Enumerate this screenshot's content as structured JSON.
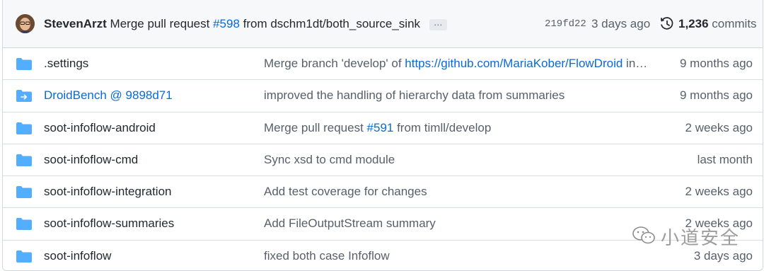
{
  "latest_commit": {
    "author": "StevenArzt",
    "message_prefix": "Merge pull request ",
    "pr": "#598",
    "message_suffix": " from dschm1dt/both_source_sink",
    "ellipsis": "…",
    "sha": "219fd22",
    "time": "3 days ago",
    "commit_count": "1,236",
    "commits_label": "commits"
  },
  "colors": {
    "folder": "#54aeff",
    "link": "#0969da",
    "muted": "#57606a"
  },
  "rows": [
    {
      "name": ".settings",
      "icon": "folder-icon",
      "type": "dir",
      "msg_prefix": "Merge branch 'develop' of ",
      "msg_link": "https://github.com/MariaKober/FlowDroid",
      "msg_suffix": " in…",
      "age": "9 months ago"
    },
    {
      "name": "DroidBench @ 9898d71",
      "icon": "submodule-icon",
      "type": "submodule",
      "msg_prefix": "improved the handling of hierarchy data from summaries",
      "msg_link": "",
      "msg_suffix": "",
      "age": "9 months ago"
    },
    {
      "name": "soot-infoflow-android",
      "icon": "folder-icon",
      "type": "dir",
      "msg_prefix": "Merge pull request ",
      "msg_link": "#591",
      "msg_suffix": " from timll/develop",
      "age": "2 weeks ago"
    },
    {
      "name": "soot-infoflow-cmd",
      "icon": "folder-icon",
      "type": "dir",
      "msg_prefix": "Sync xsd to cmd module",
      "msg_link": "",
      "msg_suffix": "",
      "age": "last month"
    },
    {
      "name": "soot-infoflow-integration",
      "icon": "folder-icon",
      "type": "dir",
      "msg_prefix": "Add test coverage for changes",
      "msg_link": "",
      "msg_suffix": "",
      "age": "2 weeks ago"
    },
    {
      "name": "soot-infoflow-summaries",
      "icon": "folder-icon",
      "type": "dir",
      "msg_prefix": "Add FileOutputStream summary",
      "msg_link": "",
      "msg_suffix": "",
      "age": "2 weeks ago"
    },
    {
      "name": "soot-infoflow",
      "icon": "folder-icon",
      "type": "dir",
      "msg_prefix": "fixed both case Infoflow",
      "msg_link": "",
      "msg_suffix": "",
      "age": "3 days ago"
    }
  ],
  "watermark": {
    "text": "小道安全",
    "icon": "wechat-icon"
  }
}
